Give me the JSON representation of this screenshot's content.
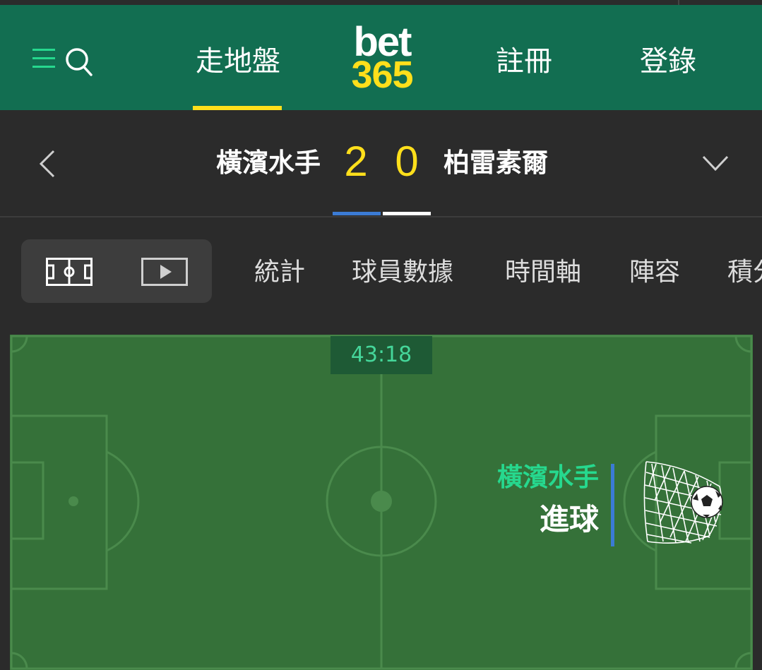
{
  "header": {
    "nav": {
      "inplay": "走地盤",
      "register": "註冊",
      "login": "登錄"
    },
    "logo": {
      "top": "bet",
      "bottom": "365"
    },
    "icons": [
      "menu-icon",
      "search-icon"
    ]
  },
  "match": {
    "home_team": "橫濱水手",
    "away_team": "柏雷素爾",
    "home_score": "2",
    "away_score": "0"
  },
  "tabs": [
    {
      "label": "統計"
    },
    {
      "label": "球員數據"
    },
    {
      "label": "時間軸"
    },
    {
      "label": "陣容"
    },
    {
      "label": "積分"
    }
  ],
  "pitch": {
    "clock": "43:18",
    "event": {
      "team": "橫濱水手",
      "type": "進球"
    }
  },
  "colors": {
    "header_bg": "#126e51",
    "accent_yellow": "#ffdf1b",
    "pitch_green": "#357139",
    "event_green": "#26d88e",
    "indicator_blue": "#3b7bd5"
  }
}
